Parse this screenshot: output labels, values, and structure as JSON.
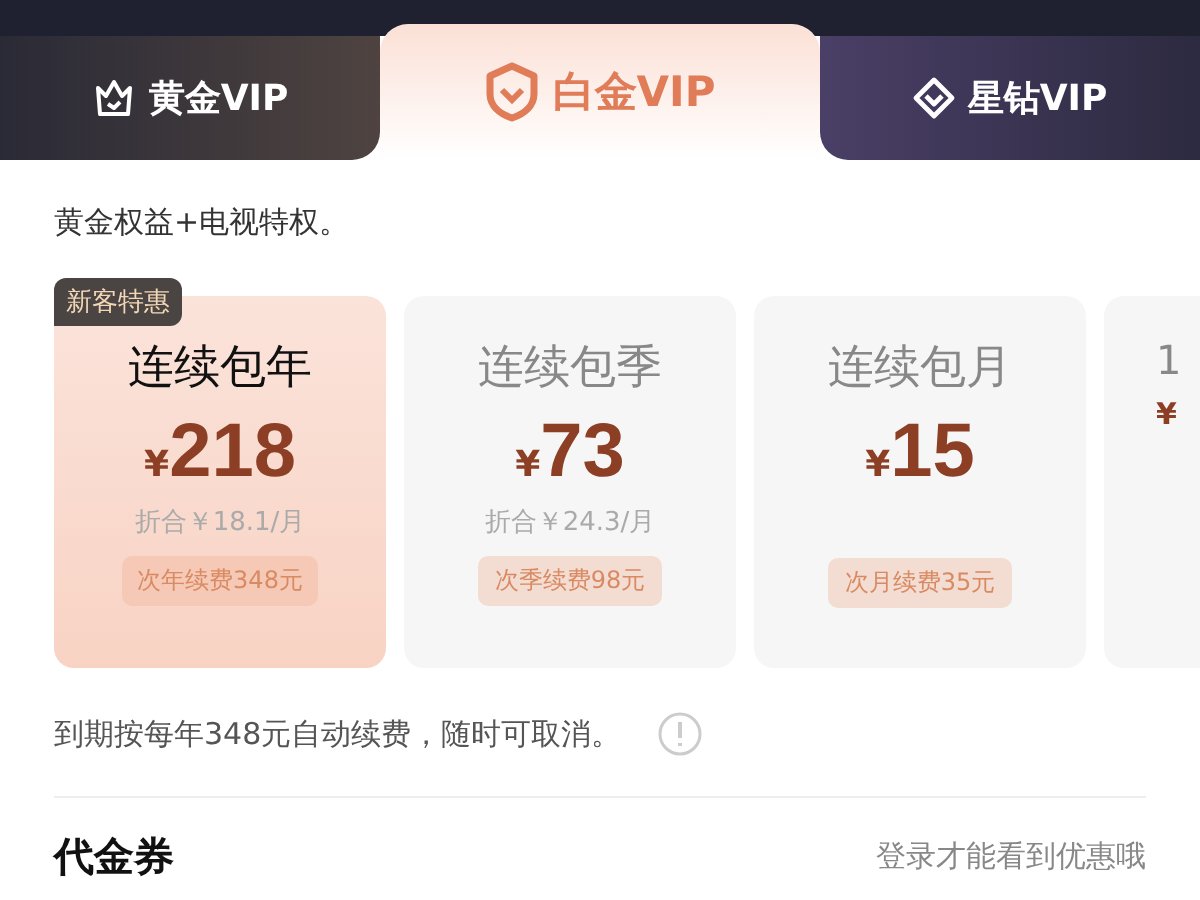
{
  "tabs": [
    {
      "label": "黄金VIP",
      "kind": "crown",
      "selected": false
    },
    {
      "label": "白金VIP",
      "kind": "shield",
      "selected": true
    },
    {
      "label": "星钻VIP",
      "kind": "diamond",
      "selected": false
    }
  ],
  "description": "黄金权益+电视特权。",
  "plans": [
    {
      "badge": "新客特惠",
      "title": "连续包年",
      "currency": "¥",
      "price": "218",
      "per_month": "折合￥18.1/月",
      "renewal": "次年续费348元",
      "selected": true
    },
    {
      "title": "连续包季",
      "currency": "¥",
      "price": "73",
      "per_month": "折合￥24.3/月",
      "renewal": "次季续费98元",
      "selected": false
    },
    {
      "title": "连续包月",
      "currency": "¥",
      "price": "15",
      "renewal": "次月续费35元",
      "selected": false
    },
    {
      "title": "1",
      "currency": "¥",
      "selected": false
    }
  ],
  "auto_renew_note": "到期按每年348元自动续费，随时可取消。",
  "voucher": {
    "label": "代金券",
    "hint": "登录才能看到优惠哦"
  }
}
